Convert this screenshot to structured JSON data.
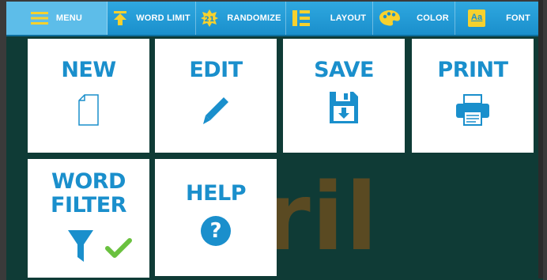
{
  "toolbar": {
    "items": [
      {
        "label": "MENU",
        "icon": "hamburger-icon"
      },
      {
        "label": "WORD LIMIT",
        "icon": "arrow-up-icon"
      },
      {
        "label": "RANDOMIZE",
        "icon": "dice-icon"
      },
      {
        "label": "LAYOUT",
        "icon": "layout-icon"
      },
      {
        "label": "COLOR",
        "icon": "palette-icon"
      },
      {
        "label": "FONT",
        "icon": "font-icon",
        "icon_text": "Aa"
      }
    ]
  },
  "menu": {
    "tiles": [
      {
        "label": "NEW",
        "icon": "new-document-icon"
      },
      {
        "label": "EDIT",
        "icon": "pencil-icon"
      },
      {
        "label": "SAVE",
        "icon": "floppy-disk-icon"
      },
      {
        "label": "PRINT",
        "icon": "printer-icon"
      },
      {
        "label_line1": "WORD",
        "label_line2": "FILTER",
        "icon": "filter-icon"
      },
      {
        "label": "HELP",
        "icon": "question-icon",
        "icon_text": "?"
      }
    ]
  },
  "background": {
    "word": "pril"
  },
  "colors": {
    "accent": "#1a8fcc",
    "toolbar": "#2fa8e0",
    "background": "#0f3b36",
    "check": "#6ac13f",
    "icon_yellow": "#f6d12e"
  }
}
